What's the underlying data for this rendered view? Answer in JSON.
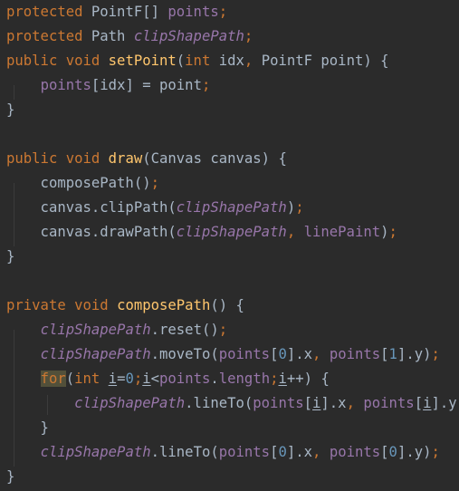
{
  "colors": {
    "background": "#2b2b2b",
    "keyword": "#cc7832",
    "plain": "#a9b7c6",
    "field": "#9876aa",
    "method_declaration": "#ffc66d",
    "number": "#6897bb",
    "indent_guide": "#3b3b3b",
    "keyword_highlight_background": "#52503a"
  },
  "lines": [
    {
      "tokens": [
        {
          "t": "protected",
          "c": "kw"
        },
        {
          "t": " PointF[] ",
          "c": "pl"
        },
        {
          "t": "points",
          "c": "fld"
        },
        {
          "t": ";",
          "c": "kw"
        }
      ]
    },
    {
      "tokens": [
        {
          "t": "protected",
          "c": "kw"
        },
        {
          "t": " Path ",
          "c": "pl"
        },
        {
          "t": "clipShapePath",
          "c": "fi"
        },
        {
          "t": ";",
          "c": "kw"
        }
      ]
    },
    {
      "tokens": [
        {
          "t": "public void ",
          "c": "kw"
        },
        {
          "t": "setPoint",
          "c": "fn"
        },
        {
          "t": "(",
          "c": "pl"
        },
        {
          "t": "int ",
          "c": "kw"
        },
        {
          "t": "idx",
          "c": "pl"
        },
        {
          "t": ", ",
          "c": "kw"
        },
        {
          "t": "PointF point) {",
          "c": "pl"
        }
      ]
    },
    {
      "tokens": [
        {
          "t": "    ",
          "c": "pl"
        },
        {
          "t": "points",
          "c": "fld"
        },
        {
          "t": "[idx] = point",
          "c": "pl"
        },
        {
          "t": ";",
          "c": "kw"
        }
      ]
    },
    {
      "tokens": [
        {
          "t": "}",
          "c": "pl"
        }
      ]
    },
    {
      "tokens": []
    },
    {
      "tokens": [
        {
          "t": "public void ",
          "c": "kw"
        },
        {
          "t": "draw",
          "c": "fn"
        },
        {
          "t": "(Canvas canvas) {",
          "c": "pl"
        }
      ]
    },
    {
      "tokens": [
        {
          "t": "    composePath()",
          "c": "pl"
        },
        {
          "t": ";",
          "c": "kw"
        }
      ]
    },
    {
      "tokens": [
        {
          "t": "    canvas.clipPath(",
          "c": "pl"
        },
        {
          "t": "clipShapePath",
          "c": "fi"
        },
        {
          "t": ")",
          "c": "pl"
        },
        {
          "t": ";",
          "c": "kw"
        }
      ]
    },
    {
      "tokens": [
        {
          "t": "    canvas.drawPath(",
          "c": "pl"
        },
        {
          "t": "clipShapePath",
          "c": "fi"
        },
        {
          "t": ", ",
          "c": "kw"
        },
        {
          "t": "linePaint",
          "c": "fld"
        },
        {
          "t": ")",
          "c": "pl"
        },
        {
          "t": ";",
          "c": "kw"
        }
      ]
    },
    {
      "tokens": [
        {
          "t": "}",
          "c": "pl"
        }
      ]
    },
    {
      "tokens": []
    },
    {
      "tokens": [
        {
          "t": "private void ",
          "c": "kw"
        },
        {
          "t": "composePath",
          "c": "fn"
        },
        {
          "t": "() {",
          "c": "pl"
        }
      ]
    },
    {
      "tokens": [
        {
          "t": "    ",
          "c": "pl"
        },
        {
          "t": "clipShapePath",
          "c": "fi"
        },
        {
          "t": ".reset()",
          "c": "pl"
        },
        {
          "t": ";",
          "c": "kw"
        }
      ]
    },
    {
      "tokens": [
        {
          "t": "    ",
          "c": "pl"
        },
        {
          "t": "clipShapePath",
          "c": "fi"
        },
        {
          "t": ".moveTo(",
          "c": "pl"
        },
        {
          "t": "points",
          "c": "fld"
        },
        {
          "t": "[",
          "c": "pl"
        },
        {
          "t": "0",
          "c": "num"
        },
        {
          "t": "].x",
          "c": "pl"
        },
        {
          "t": ", ",
          "c": "kw"
        },
        {
          "t": "points",
          "c": "fld"
        },
        {
          "t": "[",
          "c": "pl"
        },
        {
          "t": "1",
          "c": "num"
        },
        {
          "t": "].y)",
          "c": "pl"
        },
        {
          "t": ";",
          "c": "kw"
        }
      ]
    },
    {
      "tokens": [
        {
          "t": "    ",
          "c": "pl"
        },
        {
          "t": "for",
          "c": "hl"
        },
        {
          "t": "(",
          "c": "pl"
        },
        {
          "t": "int ",
          "c": "kw"
        },
        {
          "t": "i",
          "c": "lv"
        },
        {
          "t": "=",
          "c": "pl"
        },
        {
          "t": "0",
          "c": "num"
        },
        {
          "t": ";",
          "c": "kw"
        },
        {
          "t": "i",
          "c": "lv"
        },
        {
          "t": "<",
          "c": "pl"
        },
        {
          "t": "points",
          "c": "fld"
        },
        {
          "t": ".",
          "c": "pl"
        },
        {
          "t": "length",
          "c": "fld"
        },
        {
          "t": ";",
          "c": "kw"
        },
        {
          "t": "i",
          "c": "lv"
        },
        {
          "t": "++) {",
          "c": "pl"
        }
      ]
    },
    {
      "tokens": [
        {
          "t": "        ",
          "c": "pl"
        },
        {
          "t": "clipShapePath",
          "c": "fi"
        },
        {
          "t": ".lineTo(",
          "c": "pl"
        },
        {
          "t": "points",
          "c": "fld"
        },
        {
          "t": "[",
          "c": "pl"
        },
        {
          "t": "i",
          "c": "lv"
        },
        {
          "t": "].x",
          "c": "pl"
        },
        {
          "t": ", ",
          "c": "kw"
        },
        {
          "t": "points",
          "c": "fld"
        },
        {
          "t": "[",
          "c": "pl"
        },
        {
          "t": "i",
          "c": "lv"
        },
        {
          "t": "].y)",
          "c": "pl"
        },
        {
          "t": ";",
          "c": "kw"
        }
      ]
    },
    {
      "tokens": [
        {
          "t": "    }",
          "c": "pl"
        }
      ]
    },
    {
      "tokens": [
        {
          "t": "    ",
          "c": "pl"
        },
        {
          "t": "clipShapePath",
          "c": "fi"
        },
        {
          "t": ".lineTo(",
          "c": "pl"
        },
        {
          "t": "points",
          "c": "fld"
        },
        {
          "t": "[",
          "c": "pl"
        },
        {
          "t": "0",
          "c": "num"
        },
        {
          "t": "].x",
          "c": "pl"
        },
        {
          "t": ", ",
          "c": "kw"
        },
        {
          "t": "points",
          "c": "fld"
        },
        {
          "t": "[",
          "c": "pl"
        },
        {
          "t": "0",
          "c": "num"
        },
        {
          "t": "].y)",
          "c": "pl"
        },
        {
          "t": ";",
          "c": "kw"
        }
      ]
    },
    {
      "tokens": [
        {
          "t": "}",
          "c": "pl"
        }
      ]
    }
  ]
}
